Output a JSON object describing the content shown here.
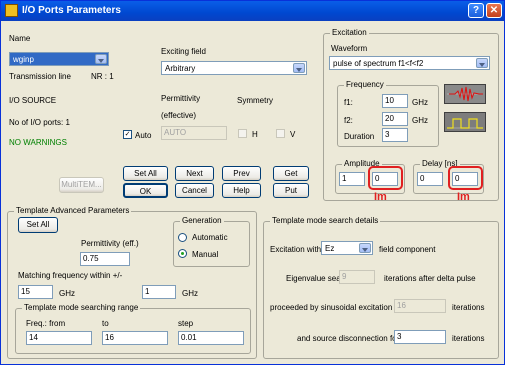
{
  "window": {
    "title": "I/O Ports Parameters",
    "help_glyph": "?",
    "close_glyph": "✕"
  },
  "left": {
    "name_label": "Name",
    "name_value": "wginp",
    "transmission_label": "Transmission line",
    "nr_label": "NR : 1",
    "io_source": "I/O SOURCE",
    "ports_count": "No of I/O ports: 1",
    "warnings": "NO WARNINGS",
    "exciting_field_label": "Exciting field",
    "exciting_field_value": "Arbitrary",
    "permittivity_label": "Permittivity",
    "permittivity_sub": "(effective)",
    "symmetry_label": "Symmetry",
    "auto_label": "Auto",
    "auto_value": "AUTO",
    "h_label": "H",
    "v_label": "V"
  },
  "buttons": {
    "multitem": "MultiTEM...",
    "set_all": "Set All",
    "next": "Next",
    "prev": "Prev",
    "get": "Get",
    "ok": "OK",
    "cancel": "Cancel",
    "help": "Help",
    "put": "Put"
  },
  "excitation": {
    "group_label": "Excitation",
    "waveform_label": "Waveform",
    "waveform_value": "pulse of spectrum f1<f<f2",
    "frequency_label": "Frequency",
    "f1_label": "f1:",
    "f1_value": "10",
    "f1_unit": "GHz",
    "f2_label": "f2:",
    "f2_value": "20",
    "f2_unit": "GHz",
    "duration_label": "Duration",
    "duration_value": "3",
    "amplitude_label": "Amplitude",
    "amplitude_re": "1",
    "amplitude_im": "0",
    "delay_label": "Delay [ns]",
    "delay_re": "0",
    "delay_im": "0",
    "im_annotation": "Im"
  },
  "template_adv": {
    "group_label": "Template Advanced Parameters",
    "set_all": "Set All",
    "permittivity_label": "Permittivity (eff.)",
    "permittivity_value": "0.75",
    "matching_label": "Matching frequency  within +/-",
    "matching_value": "15",
    "matching_unit": "GHz",
    "tol_value": "1",
    "tol_unit": "GHz",
    "generation_label": "Generation",
    "automatic_label": "Automatic",
    "manual_label": "Manual",
    "search_range_label": "Template mode searching range",
    "freq_from_label": "Freq.: from",
    "freq_from_value": "14",
    "to_label": "to",
    "to_value": "16",
    "step_label": "step",
    "step_value": "0.01"
  },
  "search_details": {
    "group_label": "Template mode search details",
    "excitation_with_label": "Excitation with",
    "excitation_with_value": "Ez",
    "field_component_label": "field component",
    "eigen_label": "Eigenvalue search",
    "eigen_value": "9",
    "eigen_suffix": "iterations after delta pulse",
    "sinus_label": "proceeded by sinusoidal excitation for",
    "sinus_value": "16",
    "sinus_suffix": "iterations",
    "disconnect_label": "and source disconnection for",
    "disconnect_value": "3",
    "disconnect_suffix": "iterations"
  }
}
